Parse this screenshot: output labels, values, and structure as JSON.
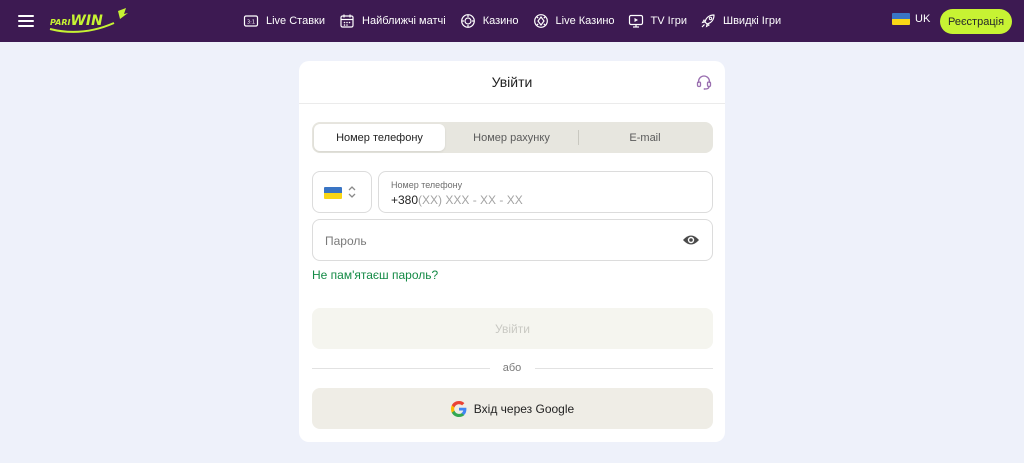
{
  "header": {
    "logo": {
      "small": "PARI",
      "big": "WIN"
    },
    "nav": [
      {
        "label": "Live Ставки",
        "icon": "live-bets-icon"
      },
      {
        "label": "Найближчі матчі",
        "icon": "calendar-icon"
      },
      {
        "label": "Казино",
        "icon": "casino-chip-icon"
      },
      {
        "label": "Live Казино",
        "icon": "live-casino-icon"
      },
      {
        "label": "TV Ігри",
        "icon": "tv-icon"
      },
      {
        "label": "Швидкі Ігри",
        "icon": "rocket-icon"
      }
    ],
    "language": "UK",
    "register_label": "Реєстрація"
  },
  "login": {
    "title": "Увійти",
    "tabs": [
      {
        "label": "Номер телефону",
        "active": true
      },
      {
        "label": "Номер рахунку",
        "active": false
      },
      {
        "label": "E-mail",
        "active": false
      }
    ],
    "phone": {
      "label": "Номер телефону",
      "prefix": "+380",
      "mask": "(XX) XXX - XX - XX"
    },
    "password_placeholder": "Пароль",
    "forgot_label": "Не пам'ятаєш пароль?",
    "submit_label": "Увійти",
    "or_label": "або",
    "google_label": "Вхід через Google"
  },
  "colors": {
    "header_bg": "#3d1a52",
    "accent": "#c7f333",
    "link": "#138a45",
    "page_bg": "#eef1fa"
  }
}
